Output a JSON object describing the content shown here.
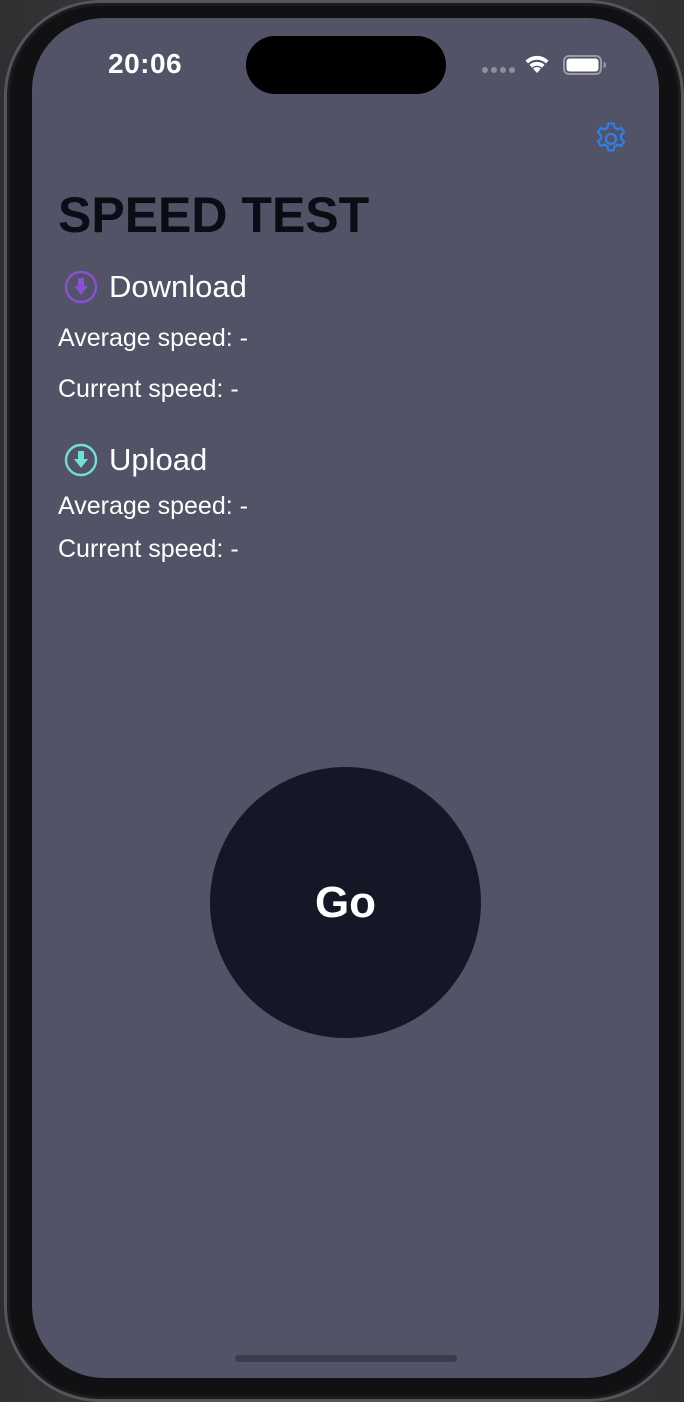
{
  "status_bar": {
    "time": "20:06"
  },
  "settings": {
    "icon": "gear-icon",
    "color": "#2f7fe8"
  },
  "title": "SPEED TEST",
  "download": {
    "label": "Download",
    "icon": "download-arrow-icon",
    "icon_color": "#8a4fd6",
    "average_speed": "Average speed: -",
    "current_speed": "Current speed: -"
  },
  "upload": {
    "label": "Upload",
    "icon": "upload-arrow-icon",
    "icon_color": "#6ee0d8",
    "average_speed": "Average speed: -",
    "current_speed": "Current speed: -"
  },
  "go_button": {
    "label": "Go"
  },
  "colors": {
    "background": "#525366",
    "title": "#0c0d14",
    "go_button": "#161726"
  }
}
